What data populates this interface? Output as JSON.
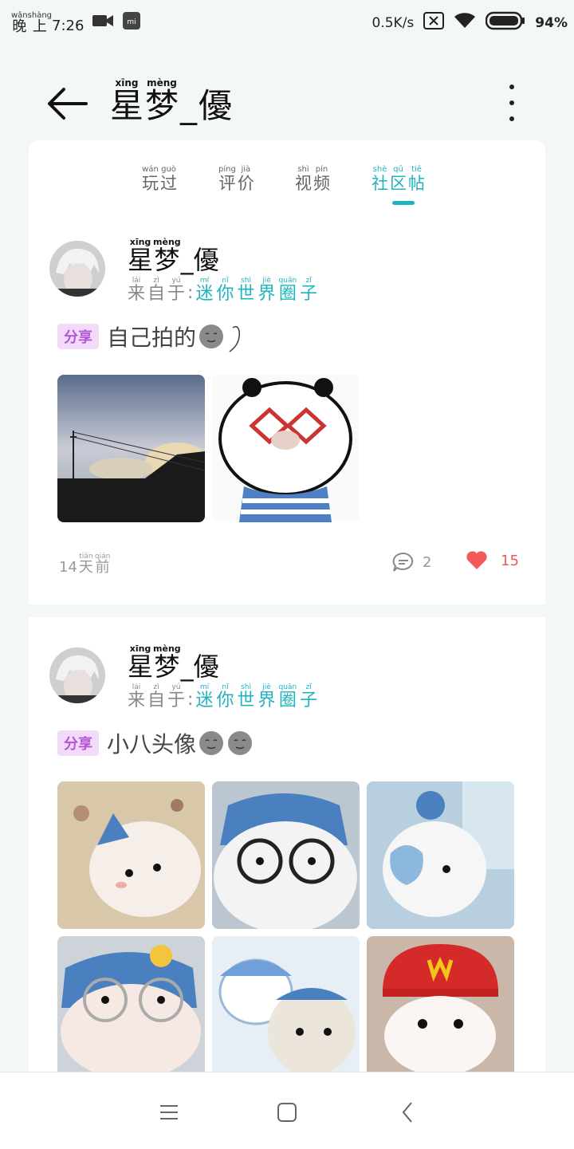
{
  "status_bar": {
    "time_prefix": "晚上",
    "time_prefix_pinyin": [
      "wǎn",
      "shàng"
    ],
    "time": "7:26",
    "net_speed": "0.5K/s",
    "battery": "94%"
  },
  "header": {
    "title_chars": [
      {
        "py": "xīng",
        "hz": "星"
      },
      {
        "py": "mèng",
        "hz": "梦"
      },
      {
        "py": "",
        "hz": "_"
      },
      {
        "py": "",
        "hz": "優"
      }
    ]
  },
  "tabs": [
    {
      "chars": [
        {
          "py": "wán",
          "hz": "玩"
        },
        {
          "py": "guò",
          "hz": "过"
        }
      ],
      "active": false
    },
    {
      "chars": [
        {
          "py": "píng",
          "hz": "评"
        },
        {
          "py": "jià",
          "hz": "价"
        }
      ],
      "active": false
    },
    {
      "chars": [
        {
          "py": "shì",
          "hz": "视"
        },
        {
          "py": "pín",
          "hz": "频"
        }
      ],
      "active": false
    },
    {
      "chars": [
        {
          "py": "shè",
          "hz": "社"
        },
        {
          "py": "qū",
          "hz": "区"
        },
        {
          "py": "tiě",
          "hz": "帖"
        }
      ],
      "active": true
    }
  ],
  "posts": [
    {
      "author_chars": [
        {
          "py": "xīng",
          "hz": "星"
        },
        {
          "py": "mèng",
          "hz": "梦"
        },
        {
          "py": "",
          "hz": "_"
        },
        {
          "py": "",
          "hz": "優"
        }
      ],
      "from_chars": [
        {
          "py": "lái",
          "hz": "来"
        },
        {
          "py": "zì",
          "hz": "自"
        },
        {
          "py": "yú",
          "hz": "于"
        }
      ],
      "from_sep": ":",
      "circle_chars": [
        {
          "py": "mí",
          "hz": "迷"
        },
        {
          "py": "nǐ",
          "hz": "你"
        },
        {
          "py": "shì",
          "hz": "世"
        },
        {
          "py": "jiè",
          "hz": "界"
        },
        {
          "py": "quān",
          "hz": "圈"
        },
        {
          "py": "zǐ",
          "hz": "子"
        }
      ],
      "tag": "分享",
      "text": "自己拍的",
      "emojis": [
        "moon-face-icon",
        "hand-heart-icon"
      ],
      "time_chars": [
        {
          "py": "",
          "hz": "14"
        },
        {
          "py": "tiān",
          "hz": "天"
        },
        {
          "py": "qián",
          "hz": "前"
        }
      ],
      "comments": "2",
      "likes": "15"
    },
    {
      "author_chars": [
        {
          "py": "xīng",
          "hz": "星"
        },
        {
          "py": "mèng",
          "hz": "梦"
        },
        {
          "py": "",
          "hz": "_"
        },
        {
          "py": "",
          "hz": "優"
        }
      ],
      "from_chars": [
        {
          "py": "lái",
          "hz": "来"
        },
        {
          "py": "zì",
          "hz": "自"
        },
        {
          "py": "yú",
          "hz": "于"
        }
      ],
      "from_sep": ":",
      "circle_chars": [
        {
          "py": "mí",
          "hz": "迷"
        },
        {
          "py": "nǐ",
          "hz": "你"
        },
        {
          "py": "shì",
          "hz": "世"
        },
        {
          "py": "jiè",
          "hz": "界"
        },
        {
          "py": "quān",
          "hz": "圈"
        },
        {
          "py": "zǐ",
          "hz": "子"
        }
      ],
      "tag": "分享",
      "text": "小八头像",
      "emojis": [
        "moon-face-icon",
        "moon-face-icon"
      ]
    }
  ],
  "colors": {
    "accent": "#1fb3c0",
    "like": "#f25a5a",
    "tag_bg": "#f1dbf8",
    "tag_fg": "#b655d6"
  }
}
